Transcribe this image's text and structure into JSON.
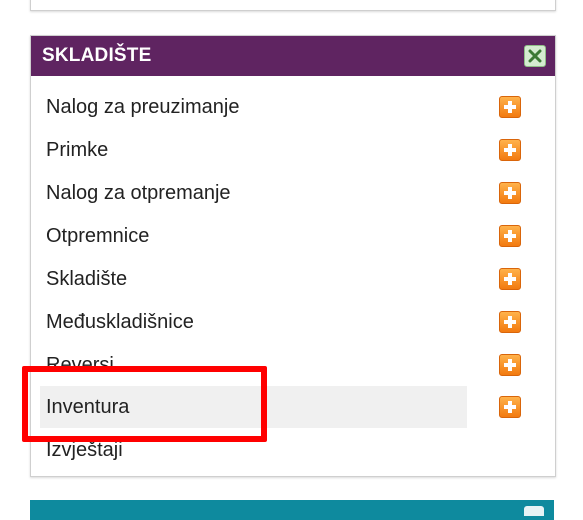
{
  "panel": {
    "title": "SKLADIŠTE",
    "header_color": "#5f2461",
    "close_icon": "close-x-icon"
  },
  "menu": {
    "items": [
      {
        "label": "Nalog za preuzimanje",
        "action_icon": "add-icon"
      },
      {
        "label": "Primke",
        "action_icon": "add-icon"
      },
      {
        "label": "Nalog za otpremanje",
        "action_icon": "add-icon"
      },
      {
        "label": "Otpremnice",
        "action_icon": "add-icon"
      },
      {
        "label": "Skladište",
        "action_icon": "add-icon"
      },
      {
        "label": "Međuskladišnice",
        "action_icon": "add-icon"
      },
      {
        "label": "Reversi",
        "action_icon": "add-icon"
      },
      {
        "label": "Inventura",
        "action_icon": "add-icon",
        "highlighted": true
      },
      {
        "label": "Izvještaji"
      }
    ]
  },
  "annotation": {
    "color": "#ff0000",
    "target": "Inventura"
  },
  "next_panel": {
    "header_color": "#0e8a9e"
  }
}
